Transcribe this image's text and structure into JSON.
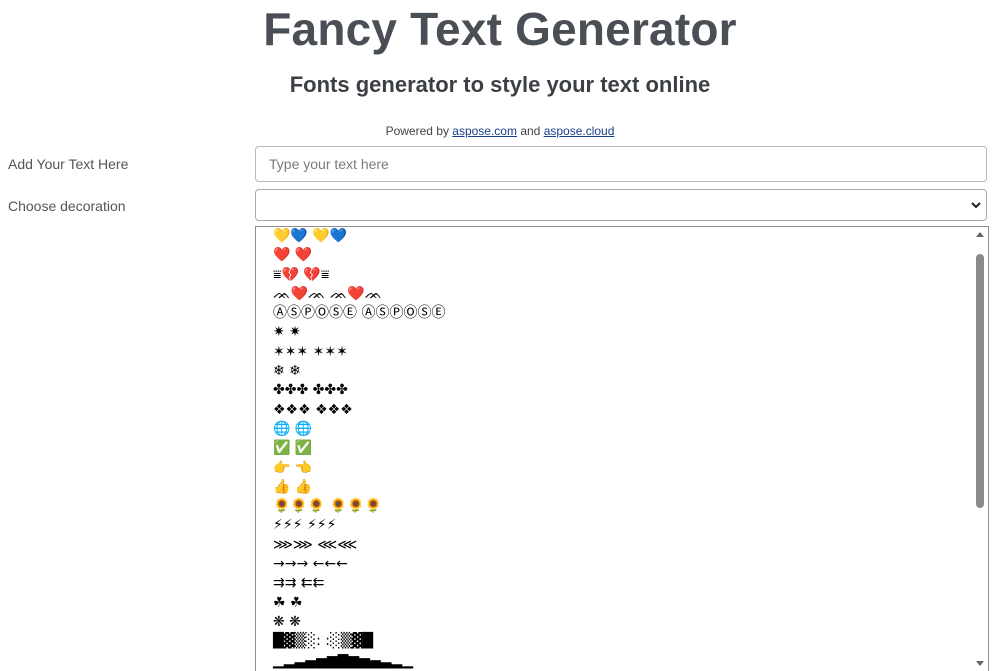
{
  "header": {
    "title": "Fancy Text Generator",
    "subtitle": "Fonts generator to style your text online",
    "powered_prefix": "Powered by ",
    "powered_link1": "aspose.com",
    "powered_and": " and ",
    "powered_link2": "aspose.cloud"
  },
  "form": {
    "text_label": "Add Your Text Here",
    "text_placeholder": "Type your text here",
    "text_value": "",
    "decoration_label": "Choose decoration",
    "decoration_selected": ""
  },
  "dropdown": {
    "options": [
      "💛💙 💛💙",
      "❤️ ❤️",
      "⩸💔 💔⩸",
      "ᨏ❤️ᨏ ᨏ❤️ᨏ",
      "ⒶⓈⓅⓄⓈⒺ ⒶⓈⓅⓄⓈⒺ",
      "✷ ✷",
      "✶✶✶ ✶✶✶",
      "❄ ❄",
      "✤✤✤ ✤✤✤",
      "❖❖❖ ❖❖❖",
      "🌐 🌐",
      "✅ ✅",
      "👉 👈",
      "👍 👍",
      "🌻🌻🌻 🌻🌻🌻",
      "⚡⚡⚡ ⚡⚡⚡",
      "⋙⋙ ⋘⋘",
      "→→→ ←←←",
      "⇉⇉ ⇇⇇",
      "☘ ☘",
      "❋ ❋",
      "█▓▒░: :░▒▓█",
      "▁▂▃▄▅▆▇▆▅▄▃▂▁",
      "👣 👣"
    ]
  },
  "colors": {
    "title": "#4a4f55",
    "link": "#1a3e8c",
    "border": "#b9b9b9",
    "scroll_thumb": "#8a8a8a"
  },
  "icons": {
    "select_chevron": "chevron-down-icon",
    "scroll_up": "scroll-up-arrow-icon",
    "scroll_down": "scroll-down-arrow-icon"
  }
}
